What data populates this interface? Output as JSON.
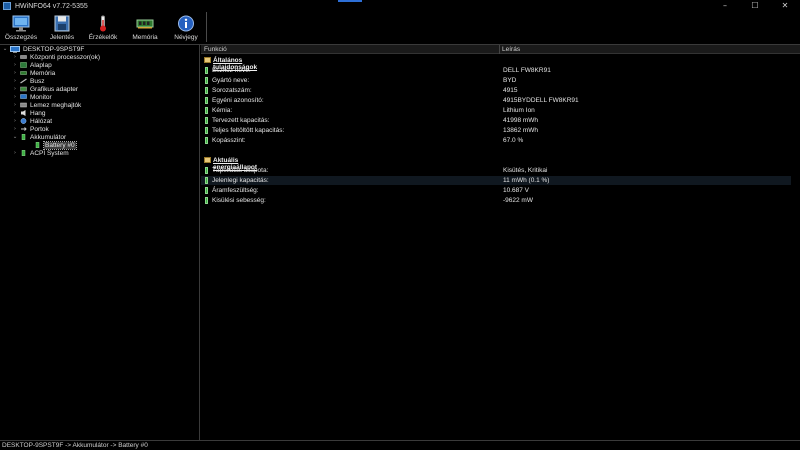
{
  "window": {
    "title": "HWiNFO64 v7.72-5355",
    "controls": {
      "minimize": "–",
      "maximize": "☐",
      "close": "✕"
    }
  },
  "toolbar": {
    "items": [
      {
        "label": "Összegzés",
        "icon": "monitor-icon"
      },
      {
        "label": "Jelentés",
        "icon": "floppy-disk-icon"
      },
      {
        "label": "Érzékelők",
        "icon": "thermometer-icon"
      },
      {
        "label": "Memória",
        "icon": "memory-module-icon"
      },
      {
        "label": "Névjegy",
        "icon": "info-icon"
      }
    ]
  },
  "tree": {
    "root": "DESKTOP-9SPST9F",
    "items": [
      {
        "label": "Központi processzor(ok)",
        "icon": "cpu-icon"
      },
      {
        "label": "Alaplap",
        "icon": "motherboard-icon"
      },
      {
        "label": "Memória",
        "icon": "memory-icon"
      },
      {
        "label": "Busz",
        "icon": "bus-icon"
      },
      {
        "label": "Grafikus adapter",
        "icon": "graphics-icon"
      },
      {
        "label": "Monitor",
        "icon": "monitor-icon"
      },
      {
        "label": "Lemez meghajtók",
        "icon": "disk-icon"
      },
      {
        "label": "Hang",
        "icon": "audio-icon"
      },
      {
        "label": "Hálózat",
        "icon": "network-icon"
      },
      {
        "label": "Portok",
        "icon": "ports-icon"
      },
      {
        "label": "Akkumulátor",
        "icon": "battery-icon"
      },
      {
        "label": "Battery #0",
        "icon": "battery-icon"
      },
      {
        "label": "ACPI System",
        "icon": "acpi-icon"
      }
    ]
  },
  "list": {
    "col_function": "Funkció",
    "col_description": "Leírás",
    "section1": "Általános tulajdonságok",
    "section1_rows": [
      {
        "key": "Eszköz neve:",
        "value": "DELL FW8KR91"
      },
      {
        "key": "Gyártó neve:",
        "value": "BYD"
      },
      {
        "key": "Sorozatszám:",
        "value": "4915"
      },
      {
        "key": "Egyéni azonosító:",
        "value": "4915BYDDELL FW8KR91"
      },
      {
        "key": "Kémia:",
        "value": "Lithium Ion"
      },
      {
        "key": "Tervezett kapacitás:",
        "value": "41998 mWh"
      },
      {
        "key": "Teljes feltöltött kapacitás:",
        "value": "13862 mWh"
      },
      {
        "key": "Kopásszint:",
        "value": "67.0 %"
      }
    ],
    "section2": "Aktuális energiaállapot",
    "section2_rows": [
      {
        "key": "Tápellátás állapota:",
        "value": "Kisütés, Kritikai"
      },
      {
        "key": "Jelenlegi kapacitás:",
        "value": "11 mWh (0.1 %)"
      },
      {
        "key": "Áramfeszültség:",
        "value": "10.687 V"
      },
      {
        "key": "Kisülési sebesség:",
        "value": "-9622 mW"
      }
    ]
  },
  "statusbar": {
    "path": "DESKTOP-9SPST9F -> Akkumulátor -> Battery #0"
  },
  "colors": {
    "accent": "#2d6fd6",
    "battery_green": "#3cb043",
    "selection": "#3d3d3d"
  }
}
